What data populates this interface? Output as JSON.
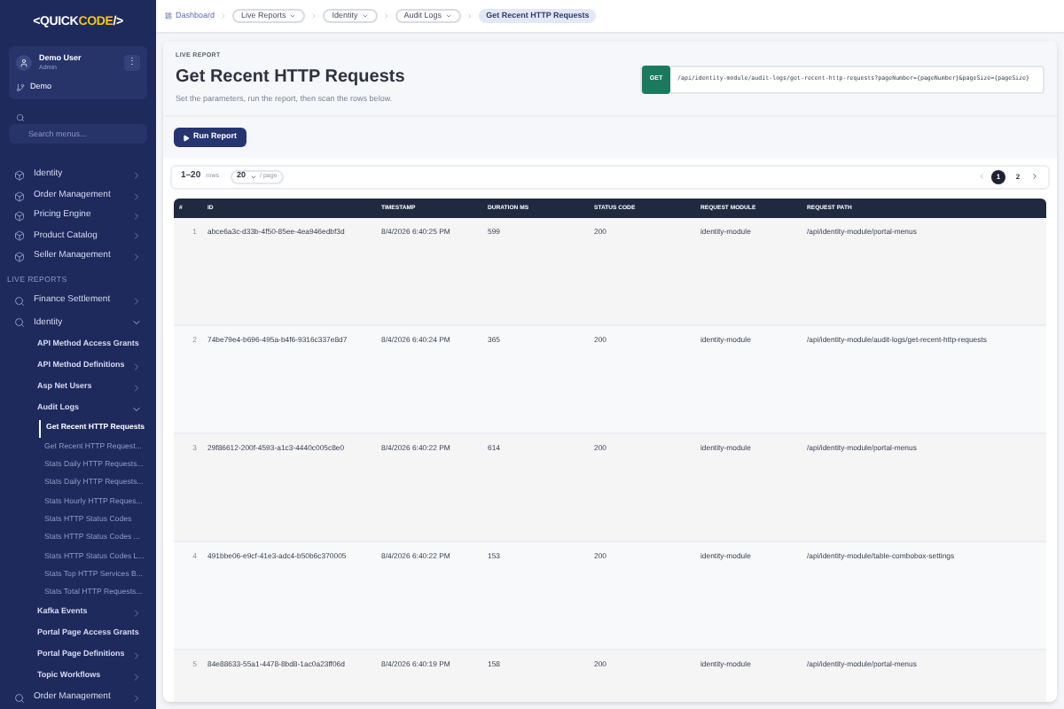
{
  "logo": {
    "prefix": "<",
    "brand": "QUICK",
    "highlight": "CODE",
    "suffix": "/>"
  },
  "user": {
    "name": "Demo User",
    "role": "Admin",
    "menu": "⋮",
    "tenant": "Demo"
  },
  "search": {
    "placeholder": "Search menus..."
  },
  "nav": [
    {
      "label": "Identity",
      "expanded": false
    },
    {
      "label": "Order Management",
      "expanded": false
    },
    {
      "label": "Pricing Engine",
      "expanded": false
    },
    {
      "label": "Product Catalog",
      "expanded": false
    },
    {
      "label": "Seller Management",
      "expanded": false
    }
  ],
  "live_reports": {
    "title": "LIVE REPORTS",
    "items": [
      {
        "label": "Finance Settlement",
        "expanded": false
      },
      {
        "label": "Identity",
        "expanded": true,
        "children": [
          {
            "label": "API Method Access Grants",
            "expanded": false
          },
          {
            "label": "API Method Definitions",
            "expanded": false
          },
          {
            "label": "Asp Net Users",
            "expanded": false
          },
          {
            "label": "Audit Logs",
            "expanded": true,
            "children": [
              {
                "label": "Get Recent HTTP Requests",
                "selected": true
              },
              {
                "label": "Get Recent HTTP Request...",
                "selected": false
              },
              {
                "label": "Stats Daily HTTP Requests...",
                "selected": false
              },
              {
                "label": "Stats Daily HTTP Requests...",
                "selected": false
              },
              {
                "label": "Stats Hourly HTTP Reques...",
                "selected": false
              },
              {
                "label": "Stats HTTP Status Codes",
                "selected": false
              },
              {
                "label": "Stats HTTP Status Codes ...",
                "selected": false
              },
              {
                "label": "Stats HTTP Status Codes L...",
                "selected": false
              },
              {
                "label": "Stats Top HTTP Services B...",
                "selected": false
              },
              {
                "label": "Stats Total HTTP Requests...",
                "selected": false
              }
            ]
          },
          {
            "label": "Kafka Events",
            "expanded": false
          },
          {
            "label": "Portal Page Access Grants",
            "expanded": false
          },
          {
            "label": "Portal Page Definitions",
            "expanded": false
          },
          {
            "label": "Topic Workflows",
            "expanded": false
          }
        ]
      },
      {
        "label": "Order Management",
        "expanded": false
      }
    ]
  },
  "breadcrumb": [
    {
      "label": "Dashboard",
      "kind": "home"
    },
    {
      "label": "Live Reports",
      "kind": "dropdown"
    },
    {
      "label": "Identity",
      "kind": "dropdown"
    },
    {
      "label": "Audit Logs",
      "kind": "dropdown"
    },
    {
      "label": "Get Recent HTTP Requests",
      "kind": "current"
    }
  ],
  "header": {
    "eyebrow": "LIVE REPORT",
    "title": "Get Recent HTTP Requests",
    "subtitle": "Set the parameters, run the report, then scan the rows below.",
    "method": "GET",
    "endpoint": "/api/identity-module/audit-logs/get-recent-http-requests?pageNumber={pageNumber}&pageSize={pageSize}"
  },
  "run_button": "Run Report",
  "pager": {
    "range": "1–20",
    "range_unit": "rows",
    "page_size": "20",
    "page_size_unit": "/ page",
    "pages": [
      {
        "label": "1",
        "selected": true
      },
      {
        "label": "2",
        "selected": false
      }
    ]
  },
  "table": {
    "columns": [
      "#",
      "ID",
      "TIMESTAMP",
      "DURATION MS",
      "STATUS CODE",
      "REQUEST MODULE",
      "REQUEST PATH"
    ],
    "rows": [
      [
        "1",
        "abce6a3c-d33b-4f50-85ee-4ea946edbf3d",
        "8/4/2026 6:40:25 PM",
        "599",
        "200",
        "identity-module",
        "/api/identity-module/portal-menus"
      ],
      [
        "2",
        "74be79e4-b696-495a-b4f6-9316c337e8d7",
        "8/4/2026 6:40:24 PM",
        "365",
        "200",
        "identity-module",
        "/api/identity-module/audit-logs/get-recent-http-requests"
      ],
      [
        "3",
        "29f86612-200f-4593-a1c3-4440c005c8e0",
        "8/4/2026 6:40:22 PM",
        "614",
        "200",
        "identity-module",
        "/api/identity-module/portal-menus"
      ],
      [
        "4",
        "491bbe06-e9cf-41e3-adc4-b50b6c370005",
        "8/4/2026 6:40:22 PM",
        "153",
        "200",
        "identity-module",
        "/api/identity-module/table-combobox-settings"
      ],
      [
        "5",
        "84e88633-55a1-4478-8bd8-1ac0a23ff06d",
        "8/4/2026 6:40:19 PM",
        "158",
        "200",
        "identity-module",
        "/api/identity-module/portal-menus"
      ]
    ]
  }
}
